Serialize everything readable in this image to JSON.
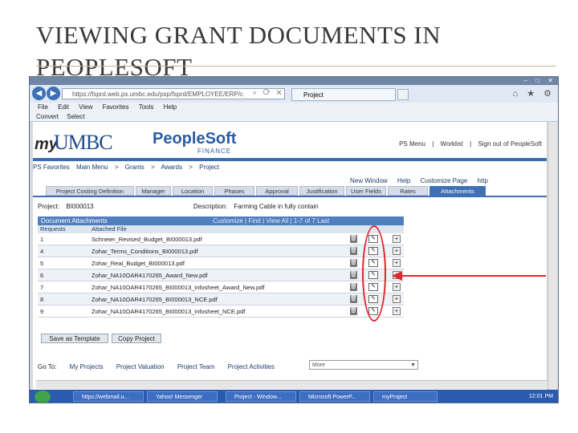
{
  "slide": {
    "title": "VIEWING GRANT DOCUMENTS IN PEOPLESOFT"
  },
  "browser": {
    "address": "https://fsprd.web.ps.umbc.edu/psp/fsprd/EMPLOYEE/ERP/c",
    "tab_label": "Project",
    "menu": [
      "File",
      "Edit",
      "View",
      "Favorites",
      "Tools",
      "Help"
    ],
    "favbar": [
      "Convert",
      "Select"
    ]
  },
  "ps": {
    "logo_my": "my",
    "logo_umbc": "UMBC",
    "logo_peoplesoft": "PeopleSoft",
    "logo_finance": "FINANCE",
    "header_links": [
      "PS Menu",
      "|",
      "Worklist",
      "|",
      "Sign out of PeopleSoft"
    ],
    "breadcrumbs": [
      "PS Favorites",
      "Main Menu",
      ">",
      "Grants",
      ">",
      "Awards",
      ">",
      "Project"
    ],
    "page_links": [
      "New Window",
      "Help",
      "Customize Page",
      "http"
    ],
    "tabs": [
      "Project Costing Definition",
      "Manager",
      "Location",
      "Phases",
      "Approval",
      "Justification",
      "User Fields",
      "Rates",
      "Attachments"
    ],
    "project_label": "Project:",
    "project_value": "BI000013",
    "description_label": "Description:",
    "description_value": "Farming Cable in fully contain",
    "grid_title": "Document Attachments",
    "grid_nav": "Customize | Find | View All |  1-7 of 7  Last",
    "col_num": "Requests",
    "col_file": "Attached File",
    "rows": [
      {
        "num": "1",
        "file": "Schneier_Revised_Budget_BI000013.pdf"
      },
      {
        "num": "4",
        "file": "Zohar_Terms_Conditions_BI000013.pdf"
      },
      {
        "num": "5",
        "file": "Zohar_Real_Budget_BI000013.pdf"
      },
      {
        "num": "6",
        "file": "Zohar_NA10OAR4170265_Award_New.pdf"
      },
      {
        "num": "7",
        "file": "Zohar_NA10OAR4170265_BI000013_infosheet_Award_New.pdf"
      },
      {
        "num": "8",
        "file": "Zohar_NA10OAR4170265_BI000013_NCE.pdf"
      },
      {
        "num": "9",
        "file": "Zohar_NA10OAR4170265_BI000013_infosheet_NCE.pdf"
      }
    ],
    "save_template": "Save as Template",
    "copy_project": "Copy Project",
    "goto_label": "Go To:",
    "goto_links": [
      "My Projects",
      "Project Valuation",
      "Project Team",
      "Project Activities"
    ],
    "more_value": "More"
  },
  "taskbar": {
    "items": [
      "https://webmail.u...",
      "Yahoo! Messenger",
      "Project - Window...",
      "Microsoft PowerP...",
      "myProject"
    ],
    "clock": "12:01 PM"
  },
  "colors": {
    "annotation": "#e3242b",
    "ps_blue": "#3f6fb4"
  }
}
